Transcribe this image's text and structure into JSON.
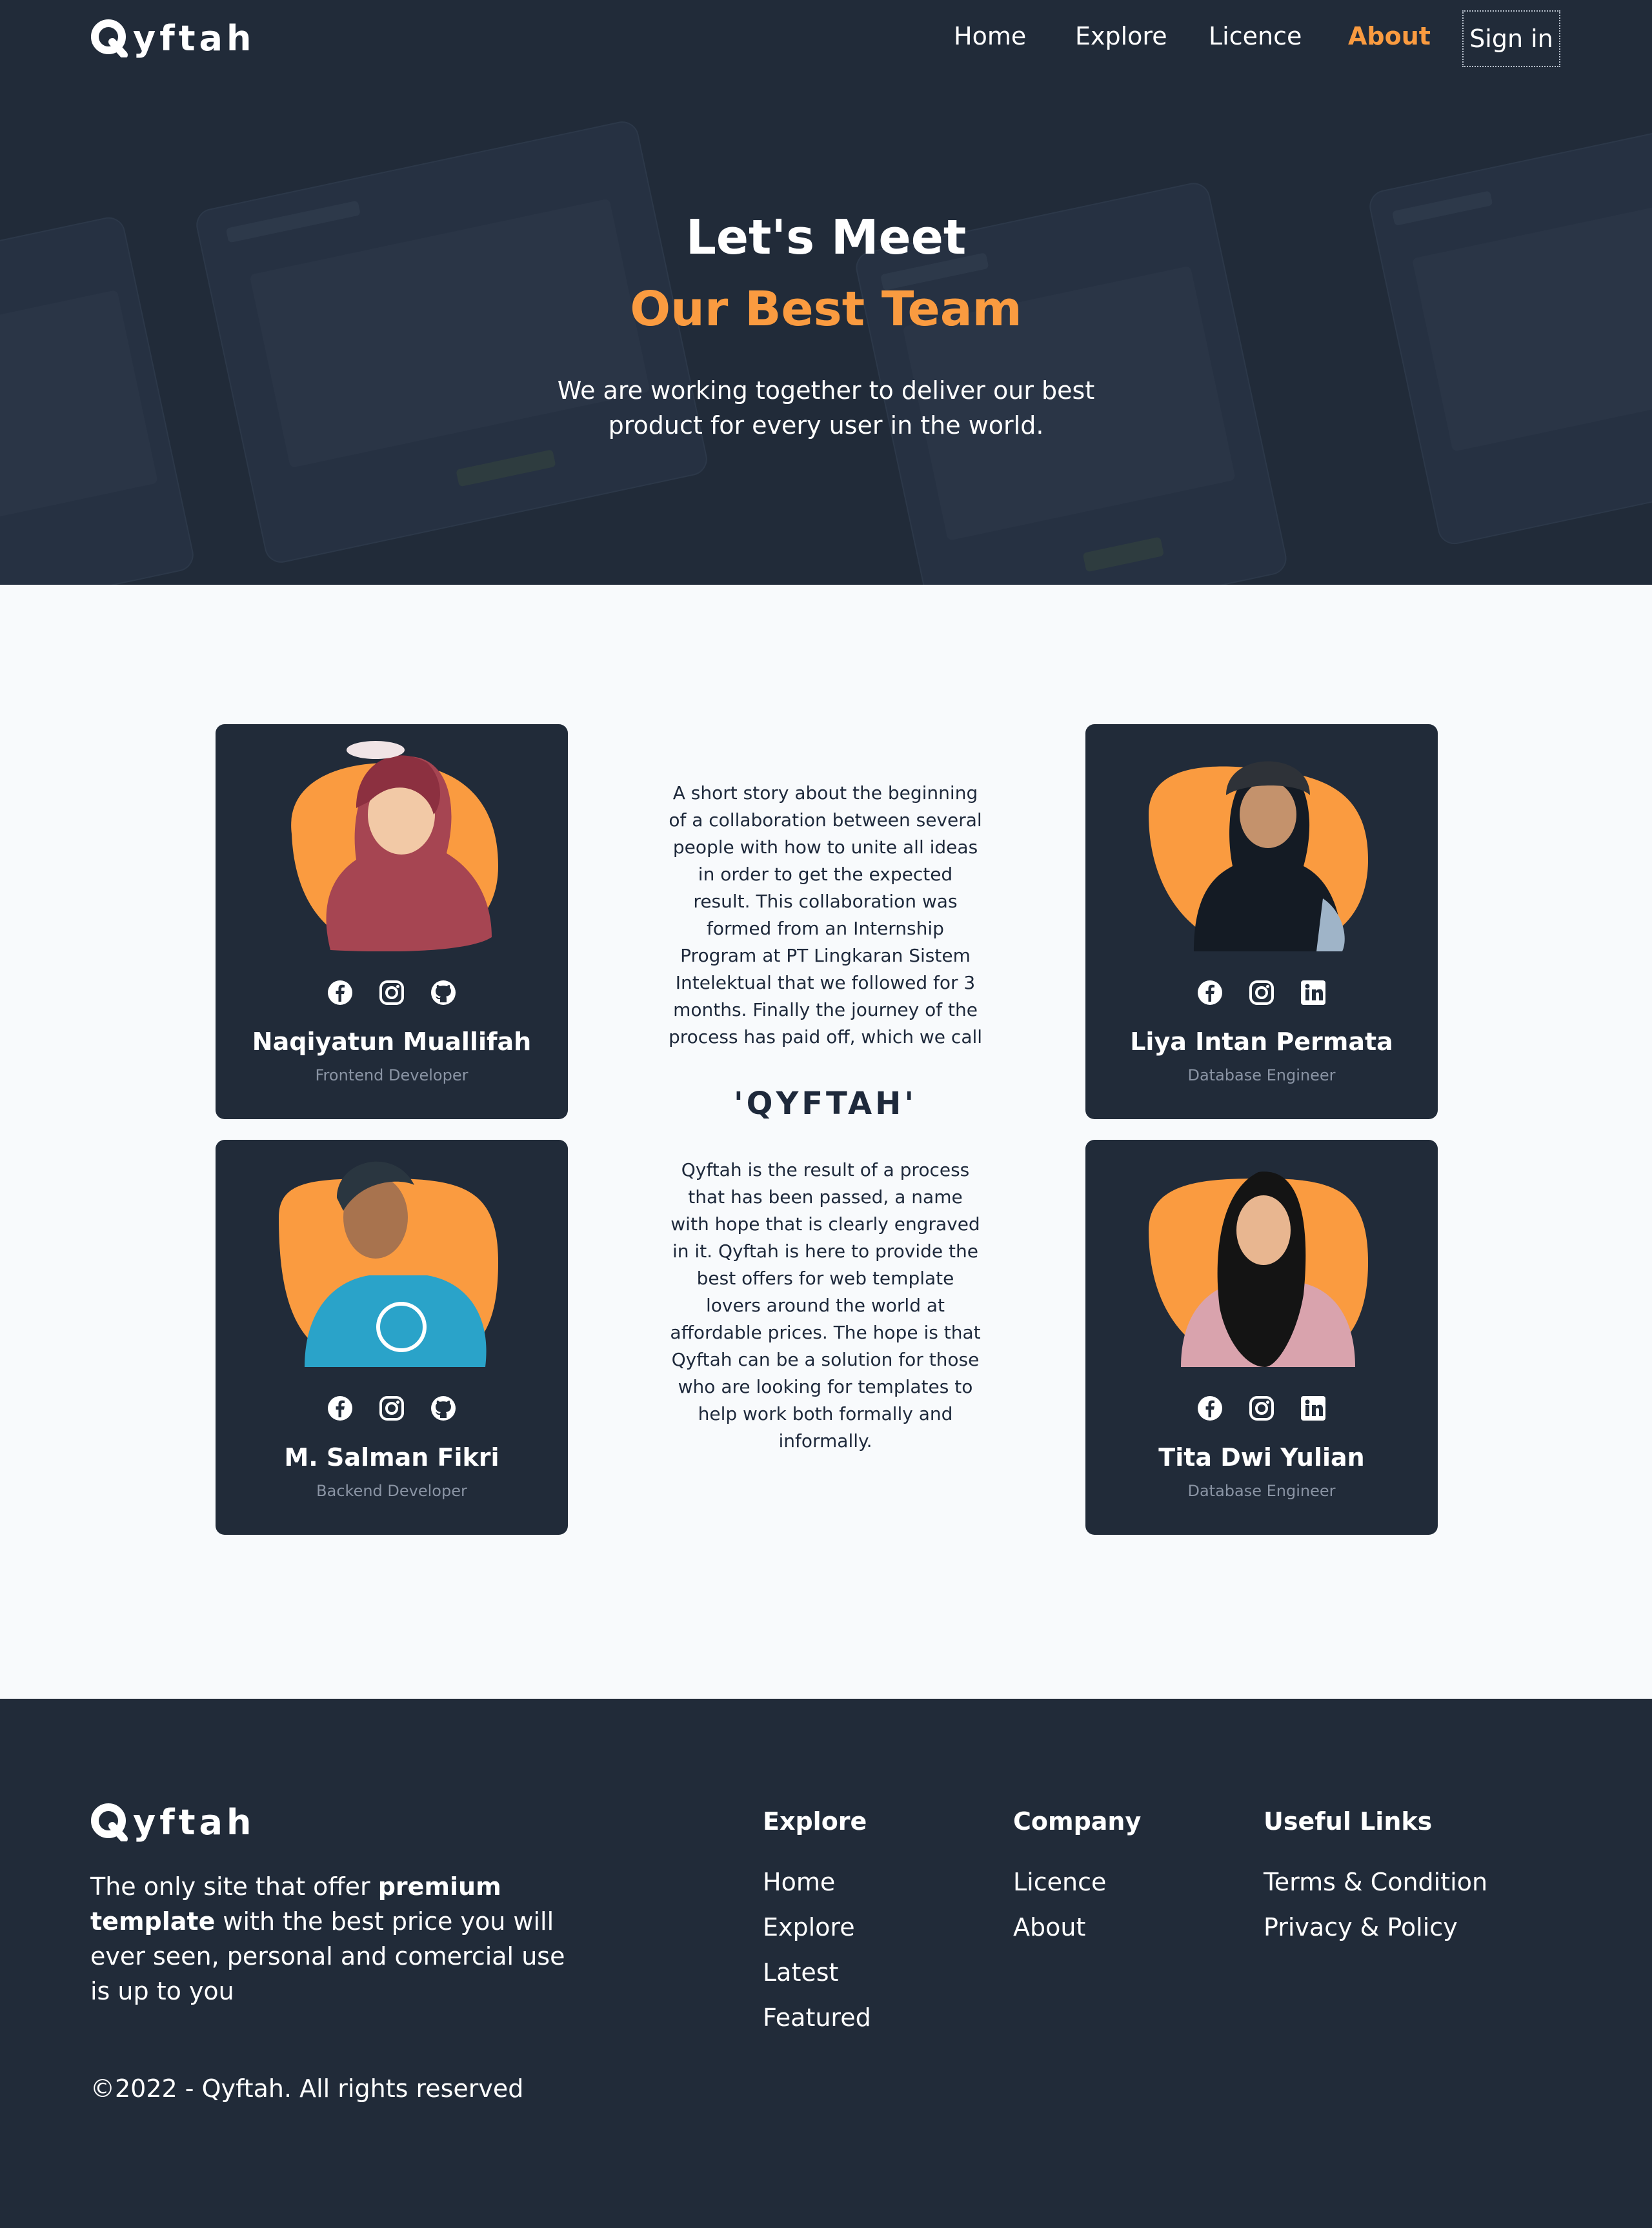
{
  "brand": {
    "name": "yftah",
    "logo_letter": "Q"
  },
  "nav": {
    "links": [
      {
        "label": "Home"
      },
      {
        "label": "Explore"
      },
      {
        "label": "Licence"
      },
      {
        "label": "About",
        "active": true
      }
    ],
    "signin_label": "Sign in"
  },
  "hero": {
    "title_line1": "Let's Meet",
    "title_line2": "Our Best Team",
    "subtitle": "We are working together to deliver our best product for every user in the world."
  },
  "team": {
    "members": [
      {
        "name": "Naqiyatun Muallifah",
        "role": "Frontend Developer",
        "socials": [
          "facebook-icon",
          "instagram-icon",
          "github-icon"
        ]
      },
      {
        "name": "Liya Intan Permata",
        "role": "Database Engineer",
        "socials": [
          "facebook-icon",
          "instagram-icon",
          "linkedin-icon"
        ]
      },
      {
        "name": "M. Salman Fikri",
        "role": "Backend Developer",
        "socials": [
          "facebook-icon",
          "instagram-icon",
          "github-icon"
        ]
      },
      {
        "name": "Tita Dwi Yulian",
        "role": "Database Engineer",
        "socials": [
          "facebook-icon",
          "instagram-icon",
          "linkedin-icon"
        ]
      }
    ],
    "story_1": "A short story about the beginning of a collaboration between several people with how to unite all ideas in order to get the expected result. This collaboration was formed from an Internship Program at PT Lingkaran Sistem Intelektual that we followed for 3 months. Finally the journey of the process has paid off, which we call",
    "story_mark": "'QYFTAH'",
    "story_2": "Qyftah is the result of a process that has been passed, a name with hope that is clearly engraved in it. Qyftah is here to provide the best offers for web template lovers around the world at affordable prices. The hope is that Qyftah can be a solution for those who are looking for templates to help work both formally and informally."
  },
  "footer": {
    "tagline_pre": "The only site that offer ",
    "tagline_bold": "premium template",
    "tagline_post": " with the best price you will ever seen, personal and comercial use is up to you",
    "copyright": "©2022 - Qyftah. All rights reserved",
    "columns": [
      {
        "title": "Explore",
        "links": [
          "Home",
          "Explore",
          "Latest",
          "Featured"
        ]
      },
      {
        "title": "Company",
        "links": [
          "Licence",
          "About"
        ]
      },
      {
        "title": "Useful Links",
        "links": [
          "Terms & Condition",
          "Privacy & Policy"
        ]
      }
    ]
  },
  "colors": {
    "dark": "#212b39",
    "accent": "#fa9b40",
    "light_bg": "#f8fafc",
    "muted": "#8a94a4"
  }
}
